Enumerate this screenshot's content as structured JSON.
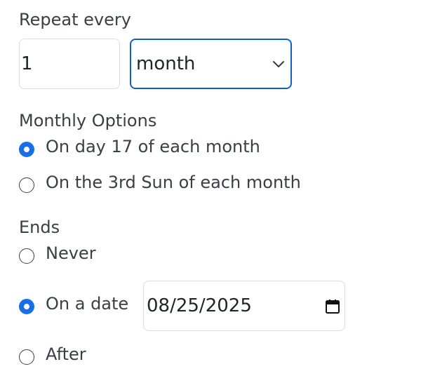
{
  "repeat": {
    "heading": "Repeat every",
    "interval_value": "1",
    "unit_selected": "month"
  },
  "monthly": {
    "heading": "Monthly Options",
    "options": [
      {
        "label": "On day 17 of each month",
        "checked": true
      },
      {
        "label": "On the 3rd Sun of each month",
        "checked": false
      }
    ]
  },
  "ends": {
    "heading": "Ends",
    "options": [
      {
        "label": "Never",
        "checked": false
      },
      {
        "label": "On a date",
        "checked": true
      },
      {
        "label": "After",
        "checked": false
      }
    ],
    "date_value": "08/25/2025"
  },
  "colors": {
    "accent": "#1a6fe8",
    "select_border": "#0d62c9",
    "text": "#3a3f44"
  },
  "icons": {
    "select_chevron": "chevron-down-icon",
    "date_picker": "calendar-icon"
  }
}
